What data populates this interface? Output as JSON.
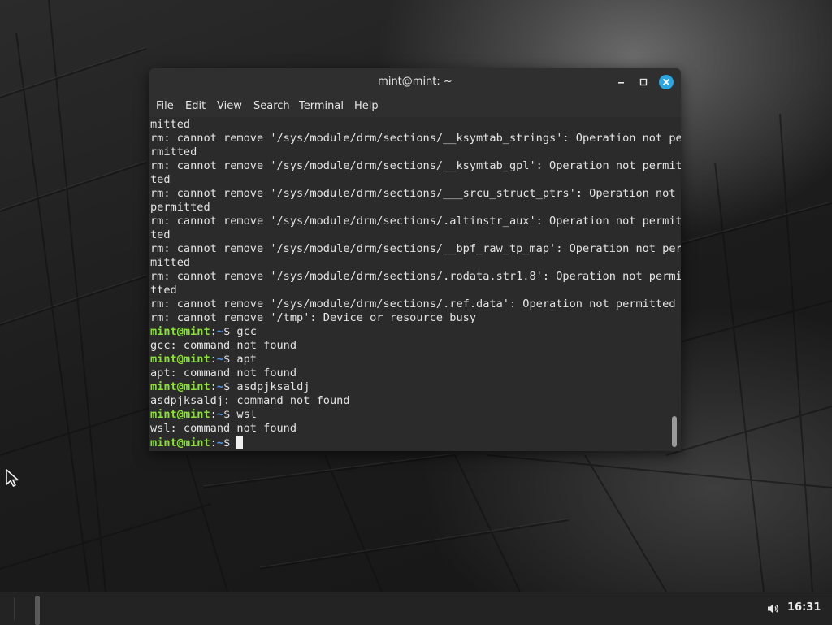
{
  "window": {
    "title": "mint@mint: ~",
    "minimize_icon": "minimize-icon",
    "maximize_icon": "maximize-icon",
    "close_icon": "close-icon",
    "accent_color": "#2aa7e0"
  },
  "menu": [
    "File",
    "Edit",
    "View",
    "Search",
    "Terminal",
    "Help"
  ],
  "terminal": {
    "prompt": {
      "user": "mint@mint",
      "sep": ":",
      "path": "~",
      "sym": "$ "
    },
    "colors": {
      "user": "#8ae234",
      "path": "#4e9ff5",
      "text": "#e4e4e4",
      "background": "#2b2b2b"
    },
    "lines": [
      {
        "text": "mitted"
      },
      {
        "text": "rm: cannot remove '/sys/module/drm/sections/__ksymtab_strings': Operation not pe"
      },
      {
        "text": "rmitted"
      },
      {
        "text": "rm: cannot remove '/sys/module/drm/sections/__ksymtab_gpl': Operation not permit"
      },
      {
        "text": "ted"
      },
      {
        "text": "rm: cannot remove '/sys/module/drm/sections/___srcu_struct_ptrs': Operation not"
      },
      {
        "text": "permitted"
      },
      {
        "text": "rm: cannot remove '/sys/module/drm/sections/.altinstr_aux': Operation not permit"
      },
      {
        "text": "ted"
      },
      {
        "text": "rm: cannot remove '/sys/module/drm/sections/__bpf_raw_tp_map': Operation not per"
      },
      {
        "text": "mitted"
      },
      {
        "text": "rm: cannot remove '/sys/module/drm/sections/.rodata.str1.8': Operation not permi"
      },
      {
        "text": "tted"
      },
      {
        "text": "rm: cannot remove '/sys/module/drm/sections/.ref.data': Operation not permitted"
      },
      {
        "text": "rm: cannot remove '/tmp': Device or resource busy"
      },
      {
        "prompt": true,
        "cmd": "gcc"
      },
      {
        "text": "gcc: command not found"
      },
      {
        "prompt": true,
        "cmd": "apt"
      },
      {
        "text": "apt: command not found"
      },
      {
        "prompt": true,
        "cmd": "asdpjksaldj"
      },
      {
        "text": "asdpjksaldj: command not found"
      },
      {
        "prompt": true,
        "cmd": "wsl"
      },
      {
        "text": "wsl: command not found"
      },
      {
        "prompt": true,
        "cmd": "",
        "cursor": true
      }
    ]
  },
  "taskbar": {
    "volume_icon": "volume-icon",
    "clock": "16:31"
  }
}
